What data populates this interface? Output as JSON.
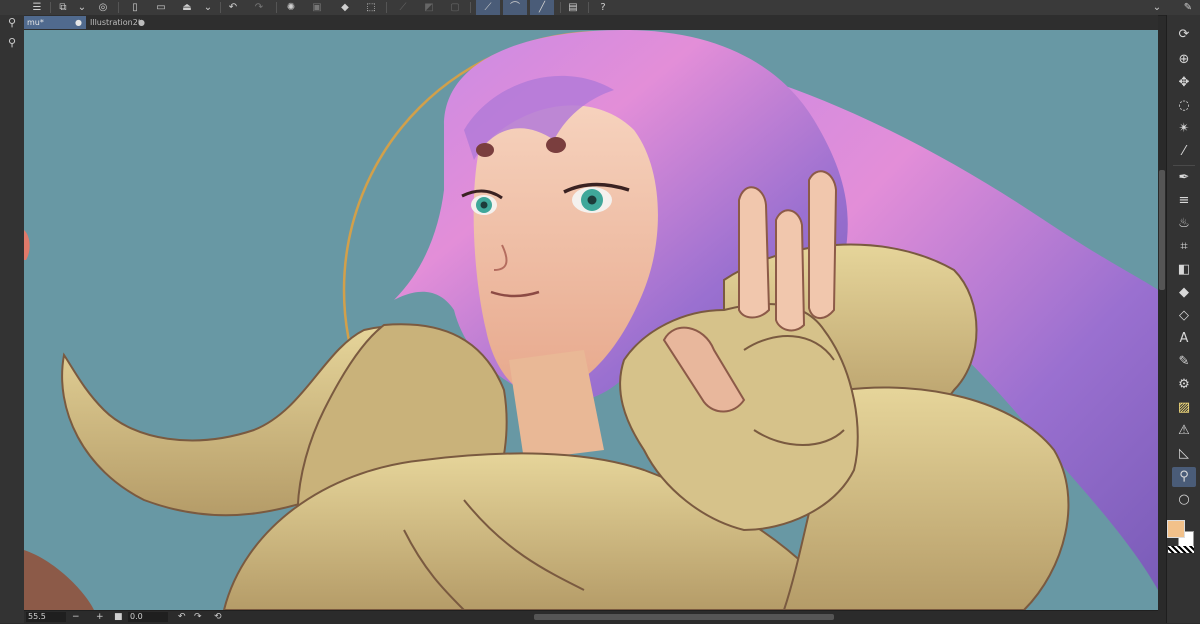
{
  "tabs": [
    {
      "label": "mu*",
      "active": true
    },
    {
      "label": "Illustration2*",
      "active": false
    }
  ],
  "status": {
    "zoom": "55.5",
    "rotation": "0.0"
  },
  "colors": {
    "main_color": "#f2c18a",
    "sub_color": "#ffffff",
    "canvas_bg": "#6898a4"
  },
  "toolbar_icons": [
    "menu-icon",
    "new-icon",
    "chevron-down-icon",
    "layers-icon",
    "document-icon",
    "folder-open-icon",
    "save-icon",
    "chevron-down-icon",
    "undo-icon",
    "redo-icon",
    "loading-icon",
    "snap-icon",
    "fill-icon",
    "crop-icon",
    "transform-icon",
    "clear-icon",
    "selection-icon",
    "pen-stabilize-icon",
    "curve-icon",
    "line-icon",
    "device-icon",
    "help-icon"
  ],
  "tools": [
    "rotate-icon",
    "zoom-tool-icon",
    "move-icon",
    "lasso-icon",
    "magic-wand-icon",
    "eyedropper-icon",
    "pen-icon",
    "lines-icon",
    "airbrush-icon",
    "decoration-icon",
    "gradient-icon",
    "fill-bucket-icon",
    "eraser-icon",
    "text-tool-icon",
    "blend-icon",
    "figure-icon",
    "ruler-icon",
    "frame-icon",
    "operation-icon",
    "balloon-icon"
  ]
}
